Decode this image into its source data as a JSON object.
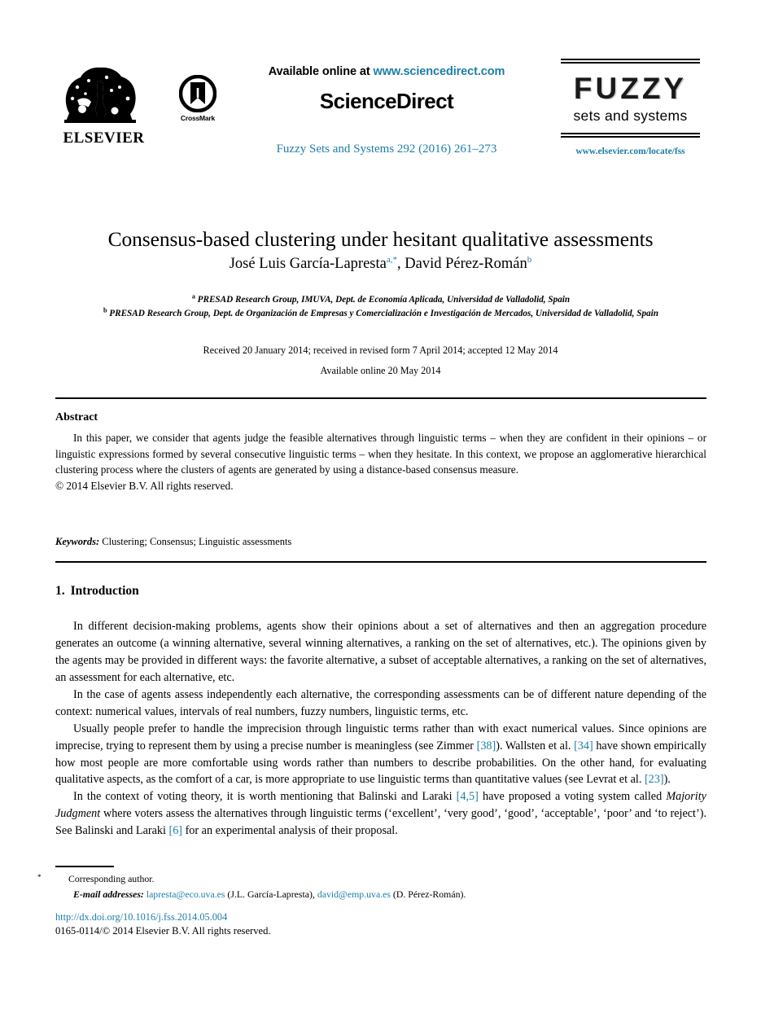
{
  "masthead": {
    "elsevier_label": "ELSEVIER",
    "crossmark_label": "CrossMark",
    "available_prefix": "Available online at ",
    "sciencedirect_url": "www.sciencedirect.com",
    "sciencedirect_wordmark": "ScienceDirect",
    "journal_reference": "Fuzzy Sets and Systems 292 (2016) 261–273",
    "journal_logo_main": "FUZZY",
    "journal_logo_sub": "sets and systems",
    "journal_url": "www.elsevier.com/locate/fss"
  },
  "article": {
    "title": "Consensus-based clustering under hesitant qualitative assessments",
    "authors": [
      {
        "name": "José Luis García-Lapresta",
        "marks": "a,*"
      },
      {
        "name": "David Pérez-Román",
        "marks": "b"
      }
    ],
    "authors_separator": ", ",
    "affiliations": [
      {
        "mark": "a",
        "text": "PRESAD Research Group, IMUVA, Dept. de Economía Aplicada, Universidad de Valladolid, Spain"
      },
      {
        "mark": "b",
        "text": "PRESAD Research Group, Dept. de Organización de Empresas y Comercialización e Investigación de Mercados, Universidad de Valladolid, Spain"
      }
    ],
    "received_line": "Received 20 January 2014; received in revised form 7 April 2014; accepted 12 May 2014",
    "available_line": "Available online 20 May 2014"
  },
  "abstract": {
    "heading": "Abstract",
    "paragraph": "In this paper, we consider that agents judge the feasible alternatives through linguistic terms – when they are confident in their opinions – or linguistic expressions formed by several consecutive linguistic terms – when they hesitate. In this context, we propose an agglomerative hierarchical clustering process where the clusters of agents are generated by using a distance-based consensus measure.",
    "copyright": "© 2014 Elsevier B.V. All rights reserved.",
    "keywords_label": "Keywords:",
    "keywords_value": "Clustering; Consensus; Linguistic assessments"
  },
  "introduction": {
    "number": "1.",
    "heading": "Introduction",
    "paragraphs": [
      "In different decision-making problems, agents show their opinions about a set of alternatives and then an aggregation procedure generates an outcome (a winning alternative, several winning alternatives, a ranking on the set of alternatives, etc.). The opinions given by the agents may be provided in different ways: the favorite alternative, a subset of acceptable alternatives, a ranking on the set of alternatives, an assessment for each alternative, etc.",
      "In the case of agents assess independently each alternative, the corresponding assessments can be of different nature depending of the context: numerical values, intervals of real numbers, fuzzy numbers, linguistic terms, etc."
    ],
    "para3": {
      "t1": "Usually people prefer to handle the imprecision through linguistic terms rather than with exact numerical values. Since opinions are imprecise, trying to represent them by using a precise number is meaningless (see Zimmer ",
      "r1": "[38]",
      "t2": "). Wallsten et al. ",
      "r2": "[34]",
      "t3": " have shown empirically how most people are more comfortable using words rather than numbers to describe probabilities. On the other hand, for evaluating qualitative aspects, as the comfort of a car, is more appropriate to use linguistic terms than quantitative values (see Levrat et al. ",
      "r3": "[23]",
      "t4": ")."
    },
    "para4": {
      "t1": "In the context of voting theory, it is worth mentioning that Balinski and Laraki ",
      "r1": "[4,5]",
      "t2": " have proposed a voting system called ",
      "i1": "Majority Judgment",
      "t3": " where voters assess the alternatives through linguistic terms (‘excellent’, ‘very good’, ‘good’, ‘acceptable’, ‘poor’ and ‘to reject’). See Balinski and Laraki ",
      "r2": "[6]",
      "t4": " for an experimental analysis of their proposal."
    }
  },
  "footer": {
    "corresponding_mark": "*",
    "corresponding_text": "Corresponding author.",
    "email_label": "E-mail addresses:",
    "email1": "lapresta@eco.uva.es",
    "email1_owner": " (J.L. García-Lapresta), ",
    "email2": "david@emp.uva.es",
    "email2_owner": " (D. Pérez-Román).",
    "doi": "http://dx.doi.org/10.1016/j.fss.2014.05.004",
    "issn_line": "0165-0114/© 2014 Elsevier B.V. All rights reserved."
  },
  "colors": {
    "link": "#1d7ea8",
    "text": "#000000",
    "background": "#ffffff"
  }
}
